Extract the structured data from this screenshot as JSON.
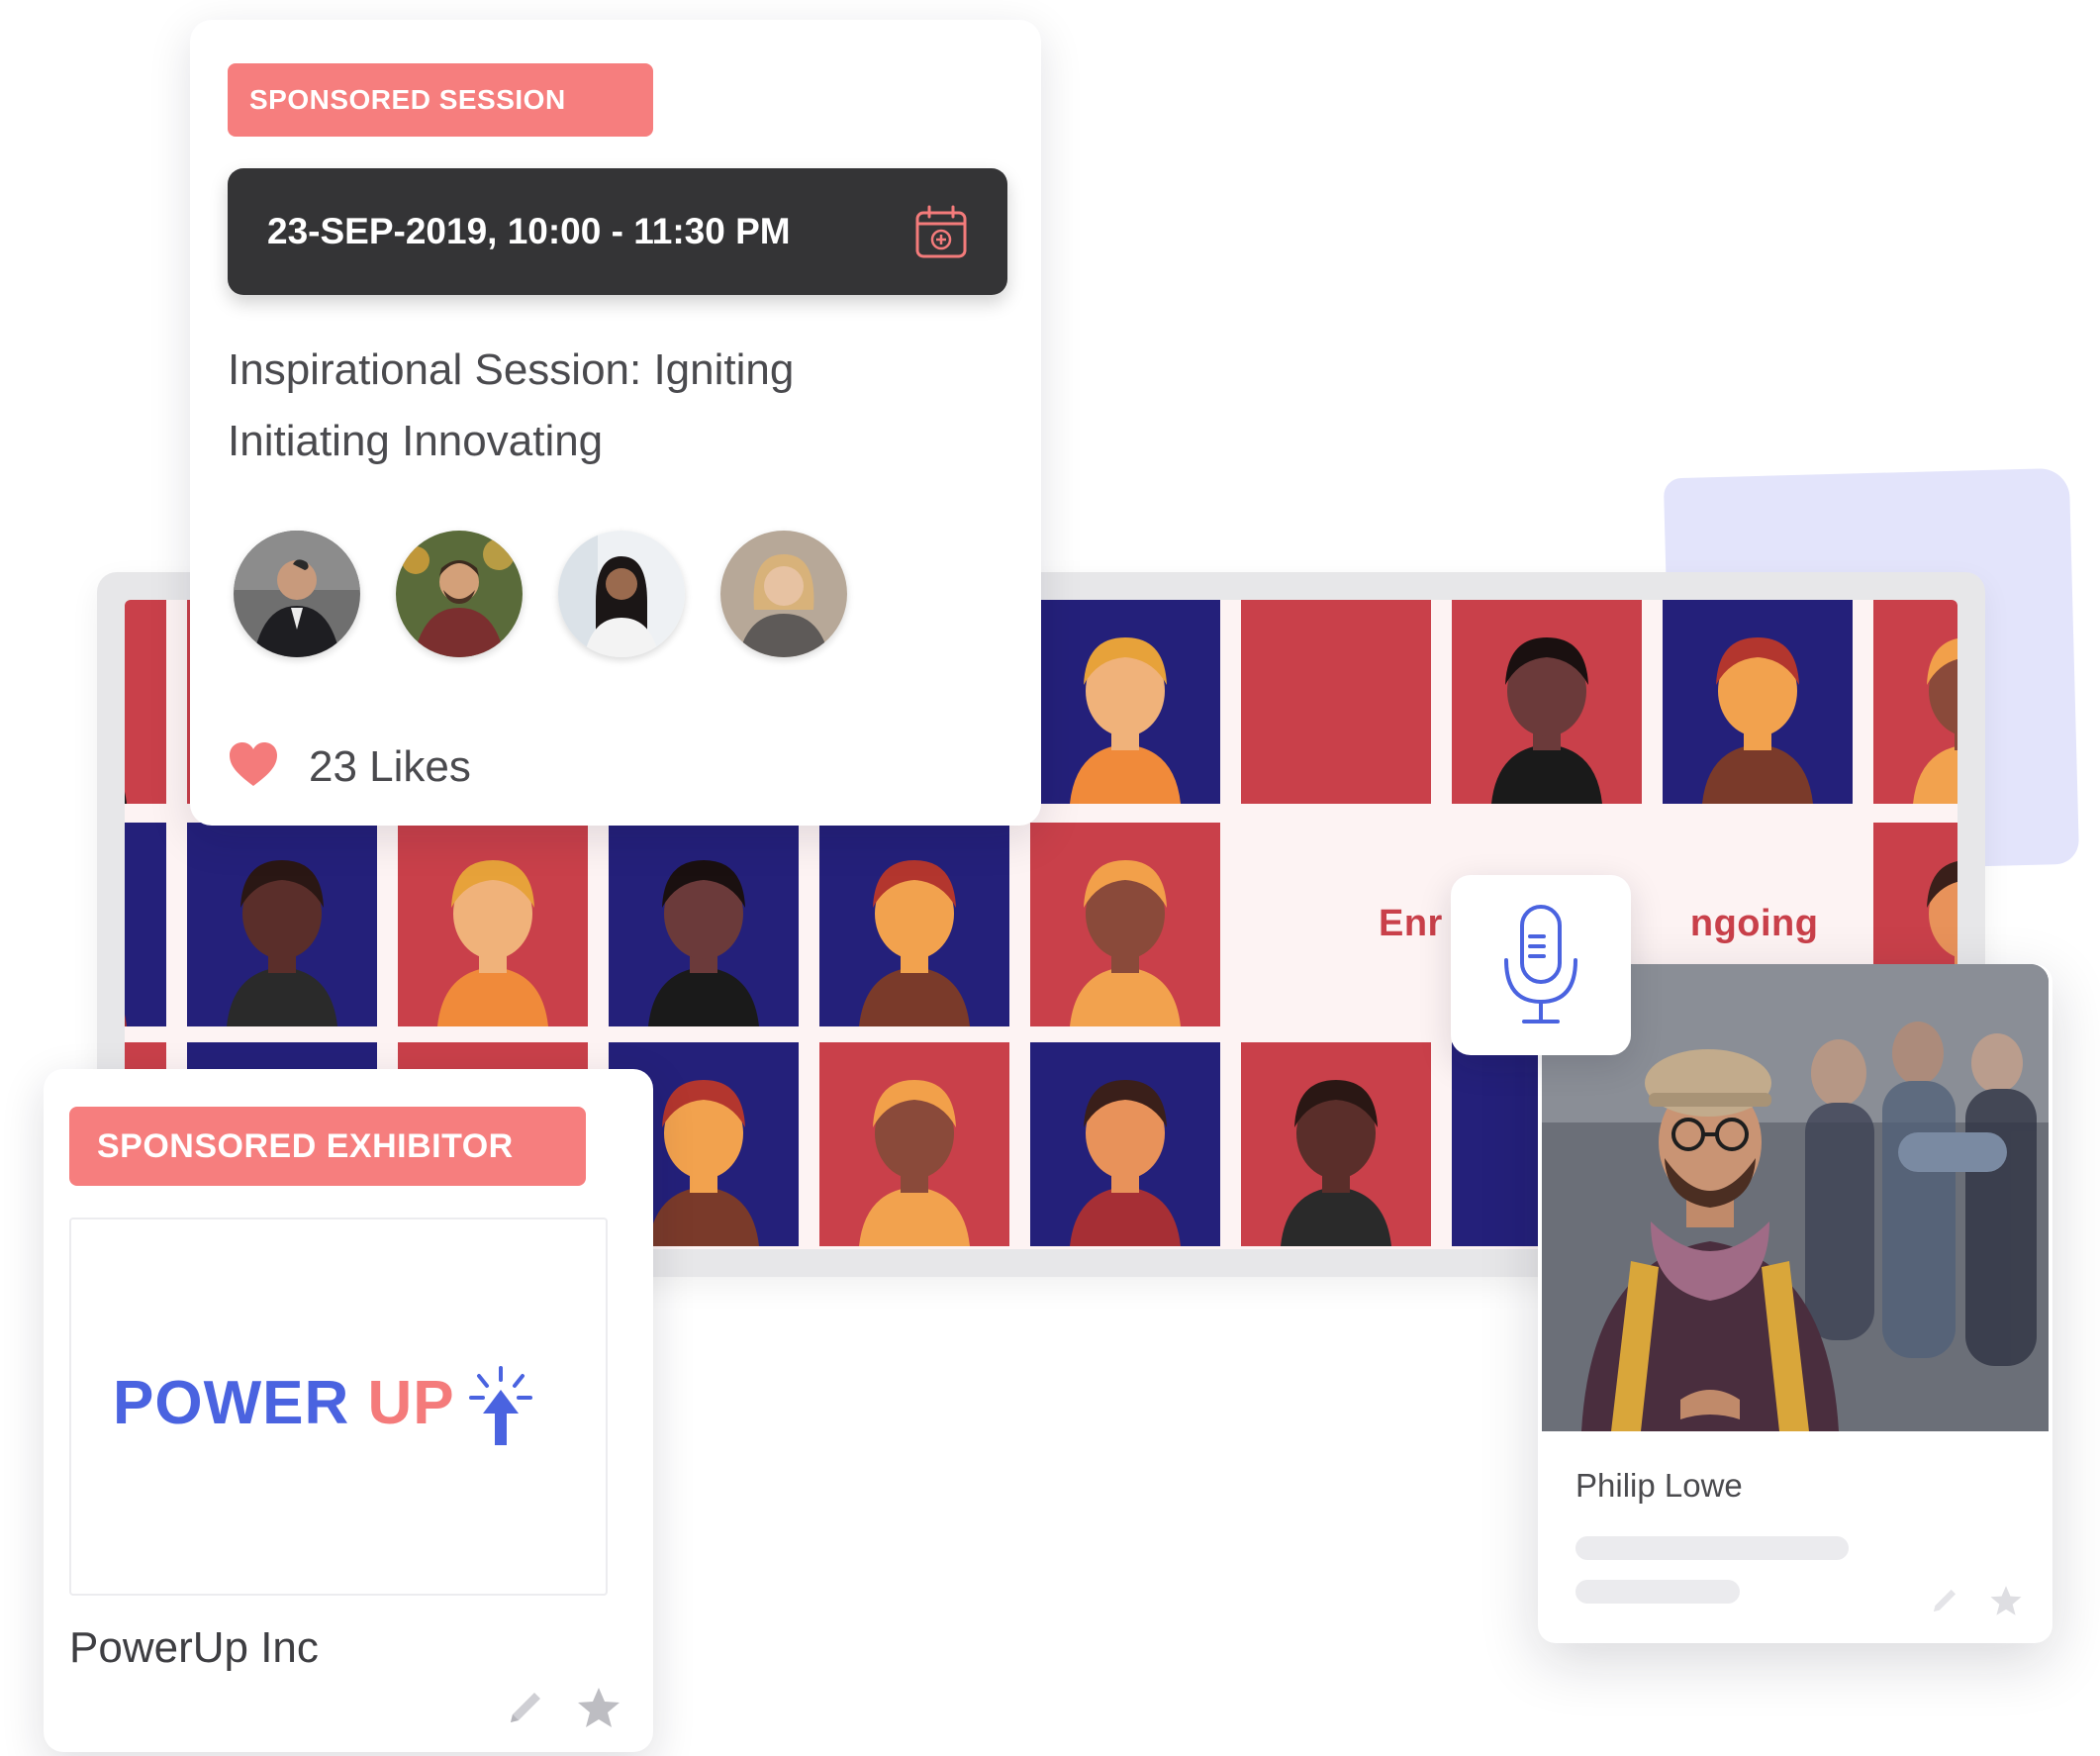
{
  "session_card": {
    "badge": "SPONSORED SESSION",
    "datetime": "23-SEP-2019,  10:00 - 11:30 PM",
    "title_line1": "Inspirational Session: Igniting",
    "title_line2": "Initiating Innovating",
    "likes_label": "23 Likes",
    "icons": {
      "calendar": "calendar-add-icon",
      "like": "heart-icon"
    }
  },
  "grid": {
    "enroll_text": "Enr",
    "ongoing_text": "ngoing",
    "colors": {
      "red": "#c9404a",
      "navy": "#24207a",
      "skin_tan": "#f2a24e"
    }
  },
  "exhibitor_card": {
    "badge": "SPONSORED EXHIBITOR",
    "logo_part1": "POWER",
    "logo_part2": "UP",
    "name": "PowerUp Inc",
    "icons": {
      "edit": "pencil-icon",
      "favorite": "star-icon"
    }
  },
  "person_card": {
    "name": "Philip Lowe",
    "icons": {
      "edit": "pencil-icon",
      "favorite": "star-icon"
    }
  },
  "mic_tile": {
    "icon": "microphone-icon"
  },
  "theme": {
    "badge_coral": "#f67e7e",
    "dark_bar": "#343436",
    "brand_blue": "#4a63e0",
    "lavender": "#e3e4fb"
  }
}
